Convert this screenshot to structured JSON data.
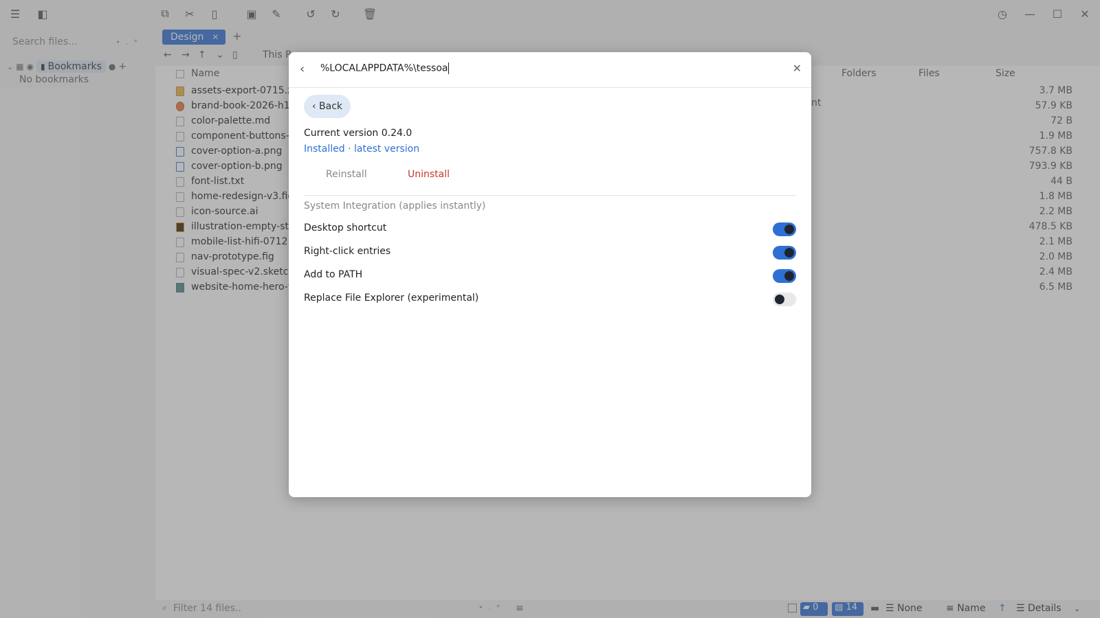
{
  "sidebar": {
    "search_placeholder": "Search files...",
    "bookmarks_label": "Bookmarks",
    "no_bookmarks": "No bookmarks"
  },
  "tabs": [
    {
      "label": "Design"
    }
  ],
  "nav": {
    "breadcrumb_partial": "This P"
  },
  "columns": {
    "name": "Name",
    "folders": "Folders",
    "files": "Files",
    "size": "Size",
    "partial_text": "nt"
  },
  "files": [
    {
      "name": "assets-export-0715.zi",
      "size": "3.7 MB"
    },
    {
      "name": "brand-book-2026-h1",
      "size": "57.9 KB"
    },
    {
      "name": "color-palette.md",
      "size": "72 B"
    },
    {
      "name": "component-buttons-",
      "size": "1.9 MB"
    },
    {
      "name": "cover-option-a.png",
      "size": "757.8 KB"
    },
    {
      "name": "cover-option-b.png",
      "size": "793.9 KB"
    },
    {
      "name": "font-list.txt",
      "size": "44 B"
    },
    {
      "name": "home-redesign-v3.fig",
      "size": "1.8 MB"
    },
    {
      "name": "icon-source.ai",
      "size": "2.2 MB"
    },
    {
      "name": "illustration-empty-sta",
      "size": "478.5 KB"
    },
    {
      "name": "mobile-list-hifi-0712.",
      "size": "2.1 MB"
    },
    {
      "name": "nav-prototype.fig",
      "size": "2.0 MB"
    },
    {
      "name": "visual-spec-v2.sketch",
      "size": "2.4 MB"
    },
    {
      "name": "website-home-hero-f",
      "size": "6.5 MB"
    }
  ],
  "statusbar": {
    "filter_placeholder": "Filter 14 files..",
    "folder_count": "0",
    "file_count": "14",
    "group_by": "None",
    "sort_by": "Name",
    "view_mode": "Details"
  },
  "dialog": {
    "path": "%LOCALAPPDATA%\\tessoa",
    "back_label": "‹ Back",
    "current_version": "Current version 0.24.0",
    "installed_status": "Installed · latest version",
    "reinstall_label": "Reinstall",
    "uninstall_label": "Uninstall",
    "section_title": "System Integration (applies instantly)",
    "options": [
      {
        "label": "Desktop shortcut",
        "enabled": true
      },
      {
        "label": "Right-click entries",
        "enabled": true
      },
      {
        "label": "Add to PATH",
        "enabled": true
      },
      {
        "label": "Replace File Explorer (experimental)",
        "enabled": false
      }
    ]
  },
  "colors": {
    "accent": "#2f6fd3",
    "danger": "#c0392b"
  }
}
